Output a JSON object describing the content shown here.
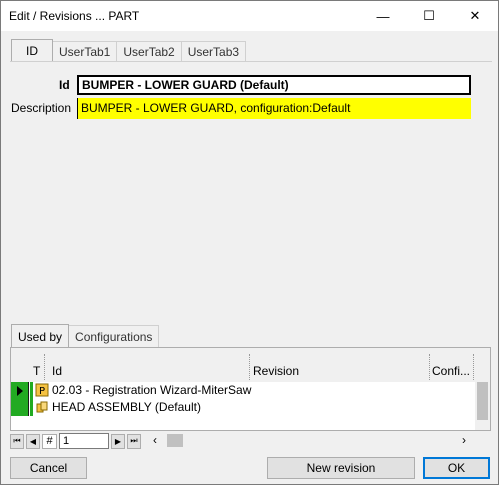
{
  "window": {
    "title": "Edit / Revisions ... PART",
    "min_icon": "minimize-icon",
    "max_icon": "maximize-icon",
    "close_icon": "close-icon"
  },
  "top_tabs": [
    "ID",
    "UserTab1",
    "UserTab2",
    "UserTab3"
  ],
  "form": {
    "id_label": "Id",
    "id_value": "BUMPER - LOWER GUARD (Default)",
    "desc_label": "Description",
    "desc_value": "BUMPER - LOWER GUARD, configuration:Default",
    "desc_bg": "#ffff00"
  },
  "bottom_tabs": [
    "Used by",
    "Configurations"
  ],
  "grid": {
    "headers": {
      "t": "T",
      "id": "Id",
      "revision": "Revision",
      "config": "Confi..."
    },
    "rows": [
      {
        "type_icon": "part-drawing-icon",
        "id": "02.03 - Registration Wizard-MiterSaw",
        "revision": "",
        "config": ""
      },
      {
        "type_icon": "assembly-icon",
        "id": "HEAD ASSEMBLY (Default)",
        "revision": "",
        "config": ""
      }
    ],
    "row_marker_color": "#22aa22"
  },
  "navigator": {
    "hash": "#",
    "page": "1"
  },
  "buttons": {
    "cancel": "Cancel",
    "new_revision": "New revision",
    "ok": "OK"
  },
  "colors": {
    "ok_border": "#0078d7"
  }
}
